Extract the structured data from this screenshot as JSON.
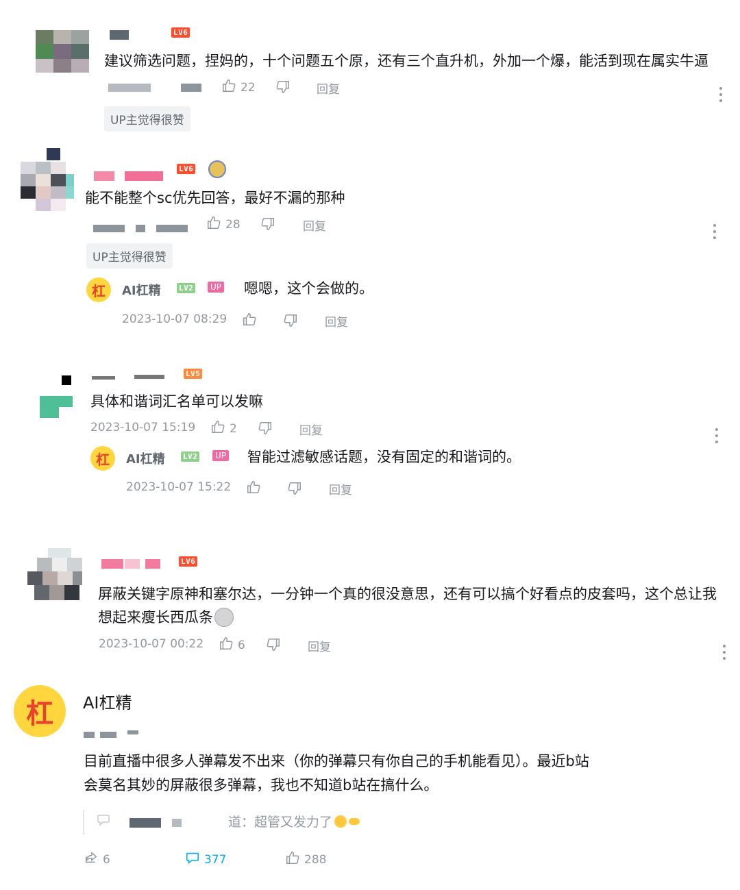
{
  "comments": [
    {
      "level": "LV6",
      "text": "建议筛选问题，捏妈的，十个问题五个原，还有三个直升机，外加一个爆，能活到现在属实牛逼",
      "likes": "22",
      "reply_label": "回复",
      "up_liked": "UP主觉得很赞"
    },
    {
      "level": "LV6",
      "text": "能不能整个sc优先回答，最好不漏的那种",
      "likes": "28",
      "reply_label": "回复",
      "up_liked": "UP主觉得很赞",
      "reply": {
        "avatar_char": "杠",
        "name": "AI杠精",
        "level": "LV2",
        "up_tag": "UP",
        "text": "嗯嗯，这个会做的。",
        "time": "2023-10-07 08:29",
        "reply_label": "回复"
      }
    },
    {
      "level": "LV5",
      "text": "具体和谐词汇名单可以发嘛",
      "time": "2023-10-07 15:19",
      "likes": "2",
      "reply_label": "回复",
      "reply": {
        "avatar_char": "杠",
        "name": "AI杠精",
        "level": "LV2",
        "up_tag": "UP",
        "text": "智能过滤敏感话题，没有固定的和谐词的。",
        "time": "2023-10-07 15:22",
        "reply_label": "回复"
      }
    },
    {
      "level": "LV6",
      "text_line1": "屏蔽关键字原神和塞尔达，一分钟一个真的很没意思，还有可以搞个好看点的皮套吗，这个总让我",
      "text_line2": "想起来瘦长西瓜条",
      "time": "2023-10-07 00:22",
      "likes": "6",
      "reply_label": "回复"
    }
  ],
  "dynamic": {
    "avatar_char": "杠",
    "name": "AI杠精",
    "text_line1": "目前直播中很多人弹幕发不出来（你的弹幕只有你自己的手机能看见）。最近b站",
    "text_line2": "会莫名其妙的屏蔽很多弹幕，我也不知道b站在搞什么。",
    "quote_text": "道：超管又发力了",
    "shares": "6",
    "comments": "377",
    "likes": "288"
  },
  "colors": {
    "accent_blue": "#00aeec",
    "meta_gray": "#9499a0",
    "level6": "#ff4d2d",
    "up_pink": "#f069a0",
    "gang_yellow": "#ffd63e"
  }
}
